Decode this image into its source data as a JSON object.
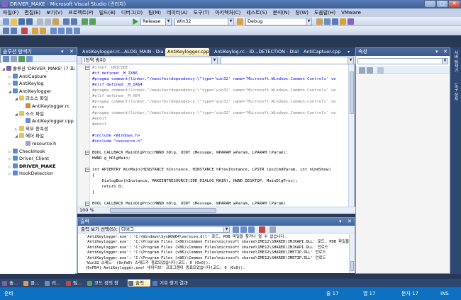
{
  "window": {
    "title": "DRIVER_MAKE - Microsoft Visual Studio (관리자)"
  },
  "menu": [
    "파일(F)",
    "편집(E)",
    "보기(V)",
    "프로젝트(P)",
    "빌드(B)",
    "디버그(D)",
    "팀(M)",
    "데이터(A)",
    "도구(T)",
    "아키텍처(C)",
    "테스트(S)",
    "분석(N)",
    "창(W)",
    "도움말(H)",
    "VMware"
  ],
  "toolbar": {
    "config": "Release",
    "platform": "Win32",
    "debug": "Debug"
  },
  "solution_explorer": {
    "title": "솔루션 탐색기",
    "items": [
      {
        "label": "솔루션 'DRIVER_MAKE' (7 프로",
        "level": 0,
        "icon": "solution-icon",
        "color": "#7a5fb0",
        "expanded": true
      },
      {
        "label": "AntiCapture",
        "level": 1,
        "icon": "project-icon",
        "color": "#5b8ad0",
        "expanded": false
      },
      {
        "label": "AntiKeylog",
        "level": 1,
        "icon": "project-icon",
        "color": "#5b8ad0",
        "expanded": false
      },
      {
        "label": "AntiKeylogger",
        "level": 1,
        "icon": "project-icon",
        "color": "#5b8ad0",
        "expanded": true
      },
      {
        "label": "리소스 파일",
        "level": 2,
        "icon": "folder-icon",
        "color": "#e8c25a",
        "expanded": true
      },
      {
        "label": "AntiKeylogger.rc",
        "level": 3,
        "icon": "rc-file-icon",
        "color": "#c88f3c",
        "expanded": null
      },
      {
        "label": "소스 파일",
        "level": 2,
        "icon": "folder-icon",
        "color": "#e8c25a",
        "expanded": true
      },
      {
        "label": "AntiKeylogger.cpp",
        "level": 3,
        "icon": "cpp-file-icon",
        "color": "#6a8cc8",
        "expanded": null
      },
      {
        "label": "외부 종속성",
        "level": 2,
        "icon": "folder-icon",
        "color": "#e8c25a",
        "expanded": false
      },
      {
        "label": "헤더 파일",
        "level": 2,
        "icon": "folder-icon",
        "color": "#e8c25a",
        "expanded": true
      },
      {
        "label": "resource.h",
        "level": 3,
        "icon": "header-file-icon",
        "color": "#9aa6c0",
        "expanded": null
      },
      {
        "label": "CheckHook",
        "level": 1,
        "icon": "project-icon",
        "color": "#5b8ad0",
        "expanded": false
      },
      {
        "label": "Driver_Client",
        "level": 1,
        "icon": "project-icon",
        "color": "#5b8ad0",
        "expanded": false
      },
      {
        "label": "DRIVER_MAKE",
        "level": 1,
        "icon": "project-icon",
        "color": "#5b8ad0",
        "expanded": false,
        "bold": true
      },
      {
        "label": "HookDetection",
        "level": 1,
        "icon": "project-icon",
        "color": "#5b8ad0",
        "expanded": false
      }
    ]
  },
  "editor": {
    "tabs": [
      "AntiKeylogger.rc...ALOG_MAIN - Dialog",
      "AntiKeylogger.cpp*",
      "AntiKeylog.rc - ID...DETECTION - Dialog",
      "AntiCaptuer.cpp"
    ],
    "active_tab": 1,
    "scope": "(전역 범위)",
    "zoom": "100 %",
    "lines": [
      {
        "t": "#ifdef _UNICODE",
        "c": "#808080"
      },
      {
        "t": "#if defined _M_IX86",
        "c": "#0000ff"
      },
      {
        "t": "#pragma comment(linker,\"/manifestdependency:\\\"type='win32' name='Microsoft.Windows.Common-Controls' ve",
        "c": "#0000ff"
      },
      {
        "t": "#elif defined _M_IA64",
        "c": "#0000ff"
      },
      {
        "t": "#pragma comment(linker,\"/manifestdependency:\\\"type='win32' name='Microsoft.Windows.Common-Controls' ve",
        "c": "#808080"
      },
      {
        "t": "#elif defined _M_X64",
        "c": "#808080"
      },
      {
        "t": "#pragma comment(linker,\"/manifestdependency:\\\"type='win32' name='Microsoft.Windows.Common-Controls' ve",
        "c": "#808080"
      },
      {
        "t": "#else",
        "c": "#808080"
      },
      {
        "t": "#pragma comment(linker,\"/manifestdependency:\\\"type='win32' name='Microsoft.Windows.Common-Controls' ve",
        "c": "#808080"
      },
      {
        "t": "#endif",
        "c": "#808080"
      },
      {
        "t": "#endif",
        "c": "#808080"
      },
      {
        "t": "",
        "c": "#000000"
      },
      {
        "t": "#include <Windows.h>",
        "c": "#0000ff"
      },
      {
        "t": "#include \"resource.h\"",
        "c": "#0000ff"
      },
      {
        "t": "",
        "c": "#000000"
      },
      {
        "t": "BOOL CALLBACK MainDlgProc(HWND hDlg, UINT iMessage, WPARAM wParam, LPARAM lParam);",
        "c": "#000000"
      },
      {
        "t": "HWND g_hDlgMain;",
        "c": "#000000"
      },
      {
        "t": "",
        "c": "#000000"
      },
      {
        "t": "int APIENTRY WinMain(HINSTANCE hInstance, HINSTANCE hPrevInstance, LPSTR lpszCmdParam, int nCmdShow)",
        "c": "#000000"
      },
      {
        "t": "{",
        "c": "#000000"
      },
      {
        "t": "    DialogBox(hInstance, MAKEINTRESOURCE(IDD_DIALOG_MAIN), HWND_DESKTOP, MainDlgProc);",
        "c": "#000000"
      },
      {
        "t": "    return 0;",
        "c": "#000000"
      },
      {
        "t": "}",
        "c": "#000000"
      },
      {
        "t": "",
        "c": "#000000"
      },
      {
        "t": "BOOL CALLBACK MainDlgProc(HWND hDlg, UINT iMessage, WPARAM wParam, LPARAM lParam)",
        "c": "#000000"
      }
    ]
  },
  "output": {
    "title": "출력",
    "source_label": "출력 보기 선택(S):",
    "source_value": "디버그",
    "lines": [
      "'AntiKeylogger.exe': 'C:\\Windows\\SysWOW64\\version.dll' 로드, PDB 파일을 찾거나 열 수 없습니다.",
      "'AntiKeylogger.exe': 'C:\\Program Files (x86)\\Common Files\\microsoft shared\\IME12\\SHARED\\IMJKAPI.DLL' 로드, PDB 파일을 찾거나",
      "'AntiKeylogger.exe': 'C:\\Program Files (x86)\\Common Files\\microsoft shared\\IME12\\SHARED\\IMJKAPI.DLL' 언로드",
      "'AntiKeylogger.exe': 'C:\\Program Files (x86)\\Common Files\\microsoft shared\\IME12\\SHARED\\IMETIP.DLL' 언로드",
      "'AntiKeylogger.exe': 'C:\\Program Files (x86)\\Common Files\\microsoft shared\\IME12\\SHARED\\IMETIP.DLL' 언로드",
      "'Win32 스레드' (0xfb0) 스레드가 종료되었습니다(코드: 0 (0x0)).",
      "[0xFB4] AntiKeylogger.exe! 네이티브' 프로그램이 종료되었습니다(코드: 0 (0x0))."
    ]
  },
  "properties": {
    "title": "속성"
  },
  "right_strip": [
    "서버 탐색기",
    "도구 상자"
  ],
  "bottom_tabs": [
    {
      "label": "솔...",
      "icon": "solution-tab-icon",
      "color": "#7a5fb0"
    },
    {
      "label": "클...",
      "icon": "class-tab-icon",
      "color": "#d8a040"
    },
    {
      "label": "리...",
      "icon": "resource-tab-icon",
      "color": "#6a8cc8"
    },
    {
      "label": "팀...",
      "icon": "team-tab-icon",
      "color": "#c04848"
    },
    {
      "label": "코드 정의 창",
      "icon": "code-def-tab-icon",
      "color": "#5aa05a"
    },
    {
      "label": "출력",
      "icon": "output-tab-icon",
      "color": "#4a6fa8",
      "active": true
    },
    {
      "label": "기호 찾기 결과",
      "icon": "find-symbol-tab-icon",
      "color": "#5a7ab8"
    }
  ],
  "status": {
    "left": "준비",
    "line": "줄 17",
    "col": "열 17",
    "char": "문자 17",
    "mode": "INS"
  }
}
